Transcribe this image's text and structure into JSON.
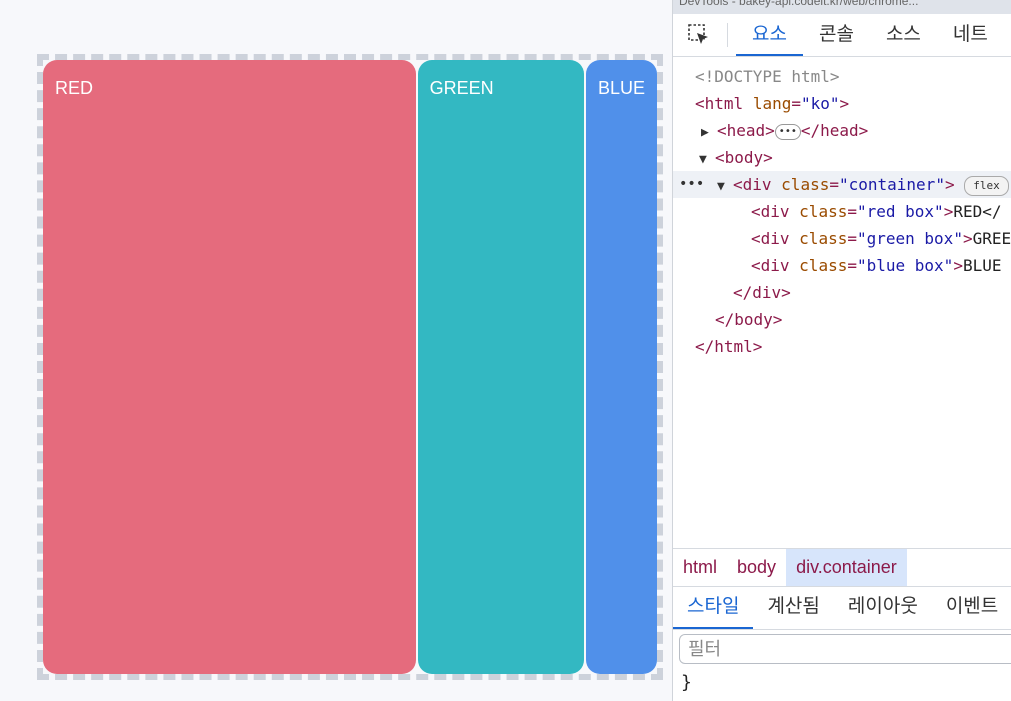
{
  "preview": {
    "boxes": [
      {
        "label": "RED",
        "color": "#e56b7d"
      },
      {
        "label": "GREEN",
        "color": "#33b8c2"
      },
      {
        "label": "BLUE",
        "color": "#5090ea"
      }
    ]
  },
  "devtools": {
    "title": "DevTools - bakey-api.codeit.kr/web/chrome...",
    "tabs": [
      "요소",
      "콘솔",
      "소스",
      "네트"
    ],
    "dom": {
      "doctype": "<!DOCTYPE html>",
      "html_open_tag": "<html",
      "html_attr": "lang",
      "html_val": "\"ko\"",
      "head_open": "<head>",
      "head_close": "</head>",
      "body_open": "<body>",
      "div_open": "<div",
      "container_attr": "class",
      "container_val": "\"container\"",
      "flex_badge": "flex",
      "child_attr": "class",
      "children": [
        {
          "val": "\"red box\"",
          "text": "RED</"
        },
        {
          "val": "\"green box\"",
          "text": "GREEN"
        },
        {
          "val": "\"blue box\"",
          "text": "BLUE"
        }
      ],
      "div_close": "</div>",
      "body_close": "</body>",
      "html_close": "</html>"
    },
    "breadcrumbs": [
      "html",
      "body",
      "div.container"
    ],
    "styles_tabs": [
      "스타일",
      "계산됨",
      "레이아웃",
      "이벤트"
    ],
    "filter_placeholder": "필터",
    "closing_brace": "}"
  },
  "colors": {
    "accent": "#1a66d2",
    "tag": "#8c1a4a"
  }
}
